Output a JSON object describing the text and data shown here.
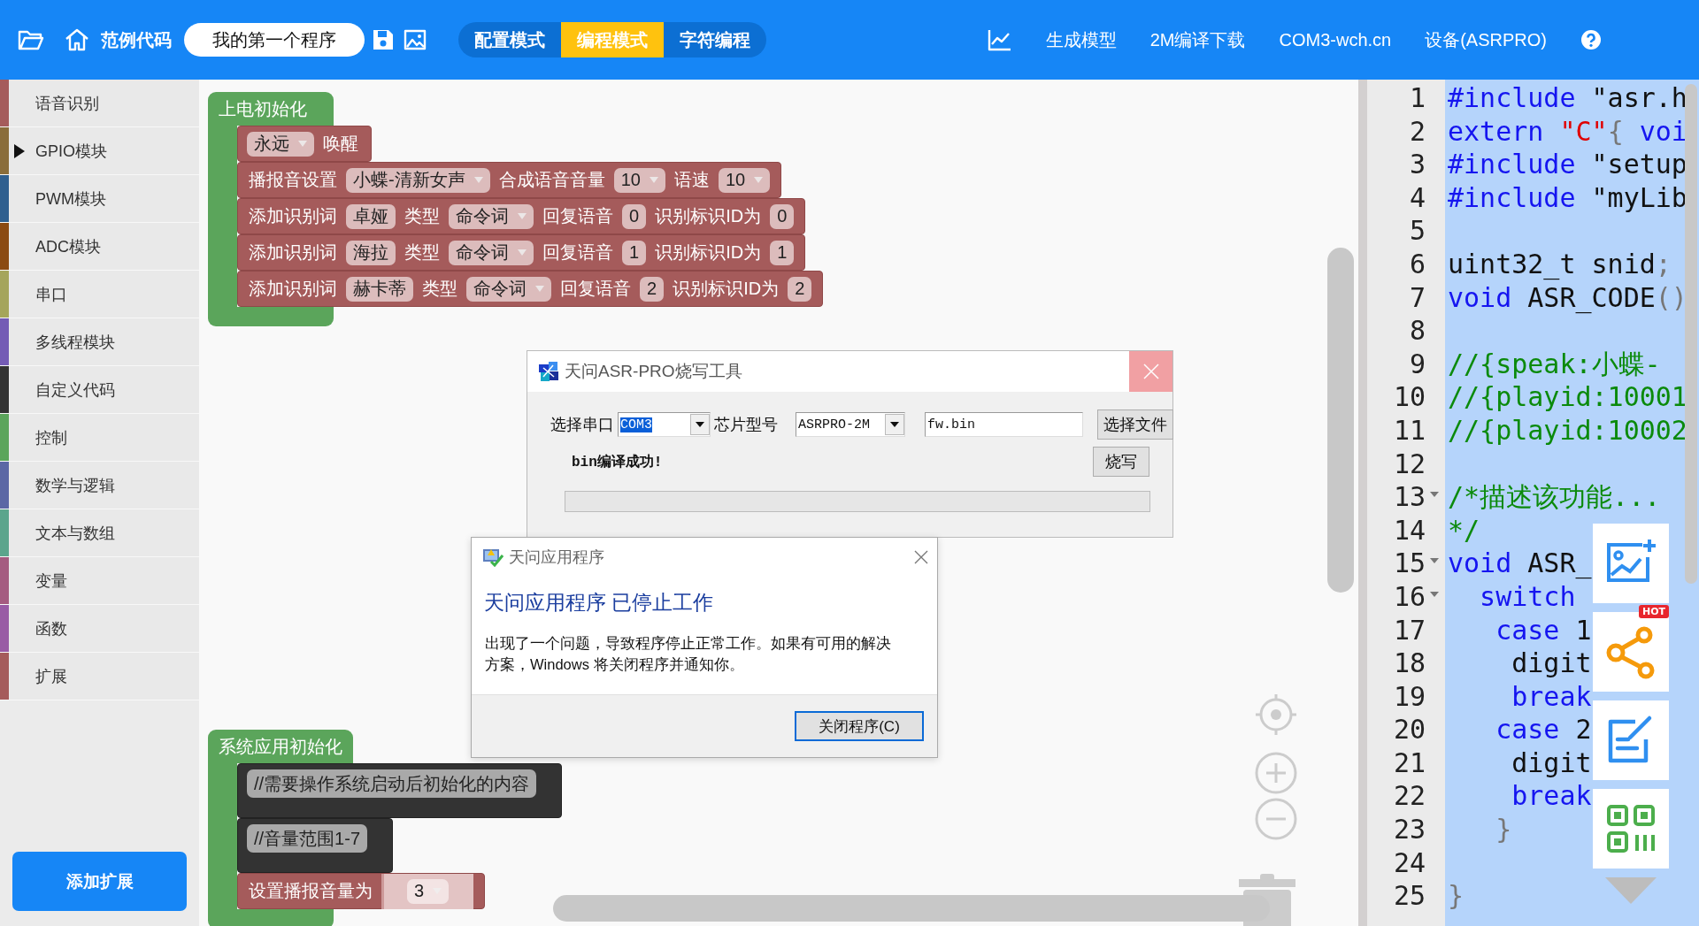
{
  "top_bar": {
    "examples_label": "范例代码",
    "program_name": "我的第一个程序",
    "modes": [
      {
        "label": "配置模式",
        "selected": false
      },
      {
        "label": "编程模式",
        "selected": true
      },
      {
        "label": "字符编程",
        "selected": false
      }
    ],
    "actions": [
      "生成模型",
      "2M编译下载",
      "COM3-wch.cn",
      "设备(ASRPRO)"
    ]
  },
  "sidebar": {
    "categories": [
      {
        "label": "语音识别",
        "color": "#a55b5b",
        "expandable": false
      },
      {
        "label": "GPIO模块",
        "color": "#8a6d3b",
        "expandable": true
      },
      {
        "label": "PWM模块",
        "color": "#2f5f8f",
        "expandable": false
      },
      {
        "label": "ADC模块",
        "color": "#8b4a12",
        "expandable": false
      },
      {
        "label": "串口",
        "color": "#a5a55b",
        "expandable": false
      },
      {
        "label": "多线程模块",
        "color": "#745bb5",
        "expandable": false
      },
      {
        "label": "自定义代码",
        "color": "#333333",
        "expandable": false
      },
      {
        "label": "控制",
        "color": "#5ba55b",
        "expandable": false
      },
      {
        "label": "数学与逻辑",
        "color": "#5b67a5",
        "expandable": false
      },
      {
        "label": "文本与数组",
        "color": "#5ba58c",
        "expandable": false
      },
      {
        "label": "变量",
        "color": "#a55b80",
        "expandable": false
      },
      {
        "label": "函数",
        "color": "#995ba5",
        "expandable": false
      },
      {
        "label": "扩展",
        "color": "#a55b5b",
        "expandable": false
      }
    ],
    "add_button": "添加扩展"
  },
  "workspace": {
    "block_groups": [
      {
        "hat": "上电初始化",
        "blocks": [
          {
            "kind": "statement",
            "parts": [
              {
                "kind": "dropdown",
                "text": "永远"
              },
              {
                "kind": "label",
                "text": "唤醒"
              }
            ]
          },
          {
            "kind": "statement",
            "parts": [
              {
                "kind": "label",
                "text": "播报音设置"
              },
              {
                "kind": "dropdown",
                "text": "小蝶-清新女声"
              },
              {
                "kind": "label",
                "text": "合成语音音量"
              },
              {
                "kind": "dropdown",
                "text": "10"
              },
              {
                "kind": "label",
                "text": "语速"
              },
              {
                "kind": "dropdown",
                "text": "10"
              }
            ]
          },
          {
            "kind": "statement",
            "parts": [
              {
                "kind": "label",
                "text": "添加识别词"
              },
              {
                "kind": "field",
                "text": "卓娅"
              },
              {
                "kind": "label",
                "text": "类型"
              },
              {
                "kind": "dropdown",
                "text": "命令词"
              },
              {
                "kind": "label",
                "text": "回复语音"
              },
              {
                "kind": "field",
                "text": "0"
              },
              {
                "kind": "label",
                "text": "识别标识ID为"
              },
              {
                "kind": "field",
                "text": "0"
              }
            ]
          },
          {
            "kind": "statement",
            "parts": [
              {
                "kind": "label",
                "text": "添加识别词"
              },
              {
                "kind": "field",
                "text": "海拉"
              },
              {
                "kind": "label",
                "text": "类型"
              },
              {
                "kind": "dropdown",
                "text": "命令词"
              },
              {
                "kind": "label",
                "text": "回复语音"
              },
              {
                "kind": "field",
                "text": "1"
              },
              {
                "kind": "label",
                "text": "识别标识ID为"
              },
              {
                "kind": "field",
                "text": "1"
              }
            ]
          },
          {
            "kind": "statement",
            "parts": [
              {
                "kind": "label",
                "text": "添加识别词"
              },
              {
                "kind": "field",
                "text": "赫卡蒂"
              },
              {
                "kind": "label",
                "text": "类型"
              },
              {
                "kind": "dropdown",
                "text": "命令词"
              },
              {
                "kind": "label",
                "text": "回复语音"
              },
              {
                "kind": "field",
                "text": "2"
              },
              {
                "kind": "label",
                "text": "识别标识ID为"
              },
              {
                "kind": "field",
                "text": "2"
              }
            ]
          }
        ]
      },
      {
        "hat": "系统应用初始化",
        "blocks": [
          {
            "kind": "comment",
            "parts": [
              {
                "kind": "field",
                "text": "//需要操作系统启动后初始化的内容"
              }
            ]
          },
          {
            "kind": "comment",
            "parts": [
              {
                "kind": "field",
                "text": "//音量范围1-7"
              }
            ]
          },
          {
            "kind": "statement",
            "parts": [
              {
                "kind": "label",
                "text": "设置播报音量为"
              },
              {
                "kind": "socket_dropdown",
                "text": "3"
              }
            ]
          }
        ]
      }
    ]
  },
  "code_editor": {
    "lines": [
      {
        "number": "1",
        "foldable": false,
        "tokens": [
          {
            "kind": "keyword",
            "text": "#include"
          },
          {
            "kind": "plain",
            "text": " \"asr.h"
          }
        ]
      },
      {
        "number": "2",
        "foldable": false,
        "tokens": [
          {
            "kind": "keyword",
            "text": "extern"
          },
          {
            "kind": "string",
            "text": " \"C\""
          },
          {
            "kind": "punct",
            "text": "{"
          },
          {
            "kind": "keyword",
            "text": " voi"
          }
        ]
      },
      {
        "number": "3",
        "foldable": false,
        "tokens": [
          {
            "kind": "keyword",
            "text": "#include"
          },
          {
            "kind": "plain",
            "text": " \"setup"
          }
        ]
      },
      {
        "number": "4",
        "foldable": false,
        "tokens": [
          {
            "kind": "keyword",
            "text": "#include"
          },
          {
            "kind": "plain",
            "text": " \"myLib"
          }
        ]
      },
      {
        "number": "5",
        "foldable": false
      },
      {
        "number": "6",
        "foldable": false,
        "tokens": [
          {
            "kind": "plain",
            "text": "uint32_t snid"
          },
          {
            "kind": "punct",
            "text": ";"
          }
        ]
      },
      {
        "number": "7",
        "foldable": false,
        "tokens": [
          {
            "kind": "keyword",
            "text": "void"
          },
          {
            "kind": "plain",
            "text": " ASR_CODE"
          },
          {
            "kind": "punct",
            "text": "()"
          }
        ]
      },
      {
        "number": "8",
        "foldable": false
      },
      {
        "number": "9",
        "foldable": false,
        "tokens": [
          {
            "kind": "comment",
            "text": "//{speak:小蝶-"
          }
        ]
      },
      {
        "number": "10",
        "foldable": false,
        "tokens": [
          {
            "kind": "comment",
            "text": "//{playid:10001"
          }
        ]
      },
      {
        "number": "11",
        "foldable": false,
        "tokens": [
          {
            "kind": "comment",
            "text": "//{playid:10002"
          }
        ]
      },
      {
        "number": "12",
        "foldable": false
      },
      {
        "number": "13",
        "foldable": true,
        "tokens": [
          {
            "kind": "comment",
            "text": "/*描述该功能..."
          }
        ]
      },
      {
        "number": "14",
        "foldable": false,
        "tokens": [
          {
            "kind": "comment",
            "text": "*/"
          }
        ]
      },
      {
        "number": "15",
        "foldable": true,
        "tokens": [
          {
            "kind": "keyword",
            "text": "void"
          },
          {
            "kind": "plain",
            "text": " ASR_"
          }
        ]
      },
      {
        "number": "16",
        "foldable": true,
        "tokens": [
          {
            "kind": "keyword",
            "text": "  switch"
          }
        ]
      },
      {
        "number": "17",
        "foldable": false,
        "tokens": [
          {
            "kind": "keyword",
            "text": "   case"
          },
          {
            "kind": "plain",
            "text": " 1"
          }
        ]
      },
      {
        "number": "18",
        "foldable": false,
        "tokens": [
          {
            "kind": "plain",
            "text": "    digit"
          }
        ]
      },
      {
        "number": "19",
        "foldable": false,
        "tokens": [
          {
            "kind": "keyword",
            "text": "    break"
          }
        ]
      },
      {
        "number": "20",
        "foldable": false,
        "tokens": [
          {
            "kind": "keyword",
            "text": "   case"
          },
          {
            "kind": "plain",
            "text": " 2"
          }
        ]
      },
      {
        "number": "21",
        "foldable": false,
        "tokens": [
          {
            "kind": "plain",
            "text": "    digit"
          }
        ]
      },
      {
        "number": "22",
        "foldable": false,
        "tokens": [
          {
            "kind": "keyword",
            "text": "    break"
          }
        ]
      },
      {
        "number": "23",
        "foldable": false,
        "tokens": [
          {
            "kind": "punct",
            "text": "   }"
          }
        ]
      },
      {
        "number": "24",
        "foldable": false
      },
      {
        "number": "25",
        "foldable": false,
        "tokens": [
          {
            "kind": "punct",
            "text": "}"
          }
        ]
      }
    ],
    "hot_badge": "HOT"
  },
  "burn_dialog": {
    "title": "天问ASR-PRO烧写工具",
    "port_label": "选择串口",
    "port_value": "COM3",
    "chip_label": "芯片型号",
    "chip_value": "ASRPRO-2M",
    "file_value": "fw.bin",
    "choose_button": "选择文件",
    "status": "bin编译成功!",
    "burn_button": "烧写",
    "progress": {
      "level": 0
    }
  },
  "crash_dialog": {
    "title": "天问应用程序",
    "heading": "天问应用程序 已停止工作",
    "message": "出现了一个问题，导致程序停止正常工作。如果有可用的解决方案，Windows 将关闭程序并通知你。",
    "close_button": "关闭程序(C)"
  }
}
